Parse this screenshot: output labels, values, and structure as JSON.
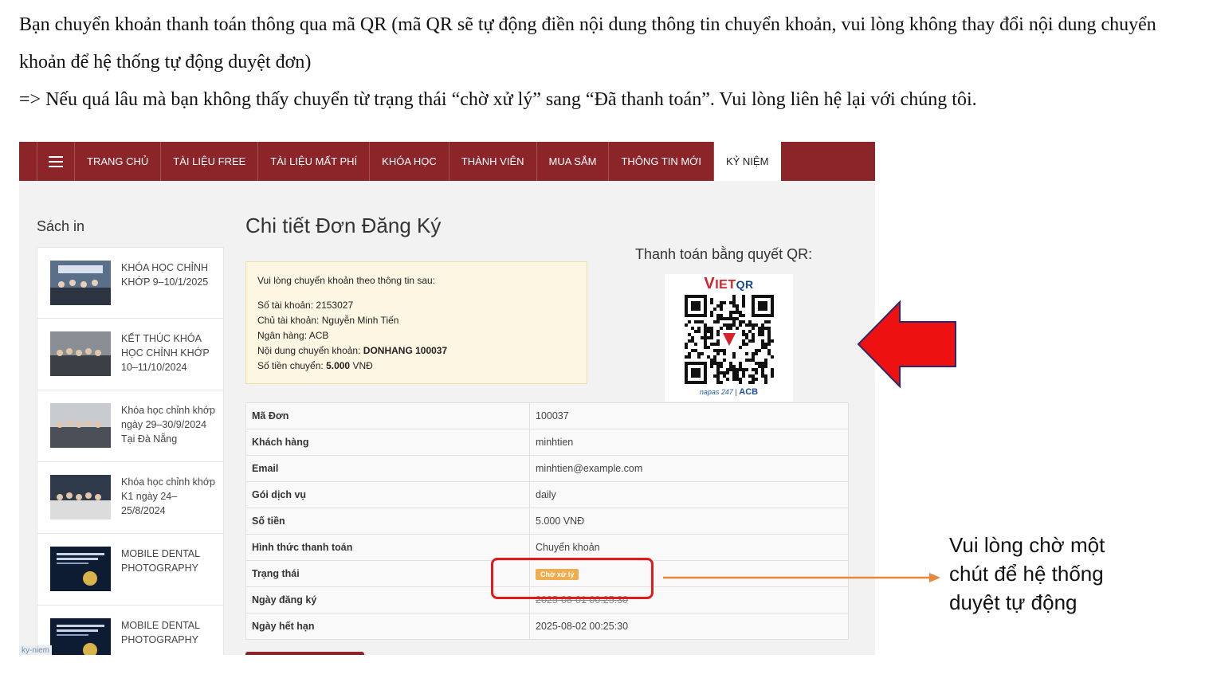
{
  "intro": {
    "line1": "Bạn chuyển khoản thanh toán thông qua mã QR (mã QR sẽ tự động điền nội dung thông tin chuyển khoản, vui lòng không thay đổi nội dung chuyển khoản để hệ thống tự động duyệt đơn)",
    "line2": "=> Nếu quá lâu mà bạn không thấy chuyển từ trạng thái “chờ xử lý” sang “Đã thanh toán”. Vui lòng liên hệ lại với chúng tôi."
  },
  "nav": {
    "items": [
      "TRANG CHỦ",
      "TÀI LIỆU FREE",
      "TÀI LIỆU MẤT PHÍ",
      "KHÓA HỌC",
      "THÀNH VIÊN",
      "MUA SẮM",
      "THÔNG TIN MỚI",
      "KỶ NIỆM"
    ]
  },
  "sidebar": {
    "title": "Sách in",
    "items": [
      {
        "label": "KHÓA HỌC CHỈNH KHỚP 9–10/1/2025"
      },
      {
        "label": "KẾT THÚC KHÓA HỌC CHỈNH KHỚP 10–11/10/2024"
      },
      {
        "label": "Khóa học chỉnh khớp ngày 29–30/9/2024 Tại Đà Nẵng"
      },
      {
        "label": "Khóa học chỉnh khớp K1 ngày 24–25/8/2024"
      },
      {
        "label": "MOBILE DENTAL PHOTOGRAPHY"
      },
      {
        "label": "MOBILE DENTAL PHOTOGRAPHY"
      }
    ]
  },
  "page": {
    "title": "Chi tiết Đơn Đăng Ký"
  },
  "transfer": {
    "lead": "Vui lòng chuyển khoản theo thông tin sau:",
    "account_label": "Số tài khoản:",
    "account": "2153027",
    "holder_label": "Chủ tài khoản:",
    "holder": "Nguyễn Minh Tiến",
    "bank_label": "Ngân hàng:",
    "bank": "ACB",
    "content_label": "Nội dung chuyển khoản:",
    "content": "DONHANG 100037",
    "amount_label": "Số tiền chuyển:",
    "amount": "5.000",
    "currency": "VNĐ"
  },
  "qr": {
    "title": "Thanh toán bằng quyết QR:",
    "brand_v": "V",
    "brand_ietqr": "IET",
    "brand_qr": "QR",
    "footer_napas": "napas 247",
    "footer_sep": "|",
    "footer_acb": "ACB"
  },
  "details": [
    {
      "key": "Mã Đơn",
      "value": "100037"
    },
    {
      "key": "Khách hàng",
      "value": "minhtien"
    },
    {
      "key": "Email",
      "value": "minhtien@example.com"
    },
    {
      "key": "Gói dịch vụ",
      "value": "daily"
    },
    {
      "key": "Số tiền",
      "value": "5.000 VNĐ"
    },
    {
      "key": "Hình thức thanh toán",
      "value": "Chuyển khoản"
    },
    {
      "key": "Trạng thái",
      "value": "Chờ xử lý"
    },
    {
      "key": "Ngày đăng ký",
      "value": "2025-08-01 00:25:30"
    },
    {
      "key": "Ngày hết hạn",
      "value": "2025-08-02 00:25:30"
    }
  ],
  "tag": "ky-niem",
  "note": {
    "line1": "Vui lòng chờ một",
    "line2": "chút để hệ thống",
    "line3": "duyệt tự động"
  },
  "colors": {
    "nav_bg": "#8b2529",
    "badge_pending": "#f0ad4e",
    "highlight_red": "#e01b1b",
    "arrow_red": "#ee1111",
    "pointer_orange": "#e8883a"
  }
}
